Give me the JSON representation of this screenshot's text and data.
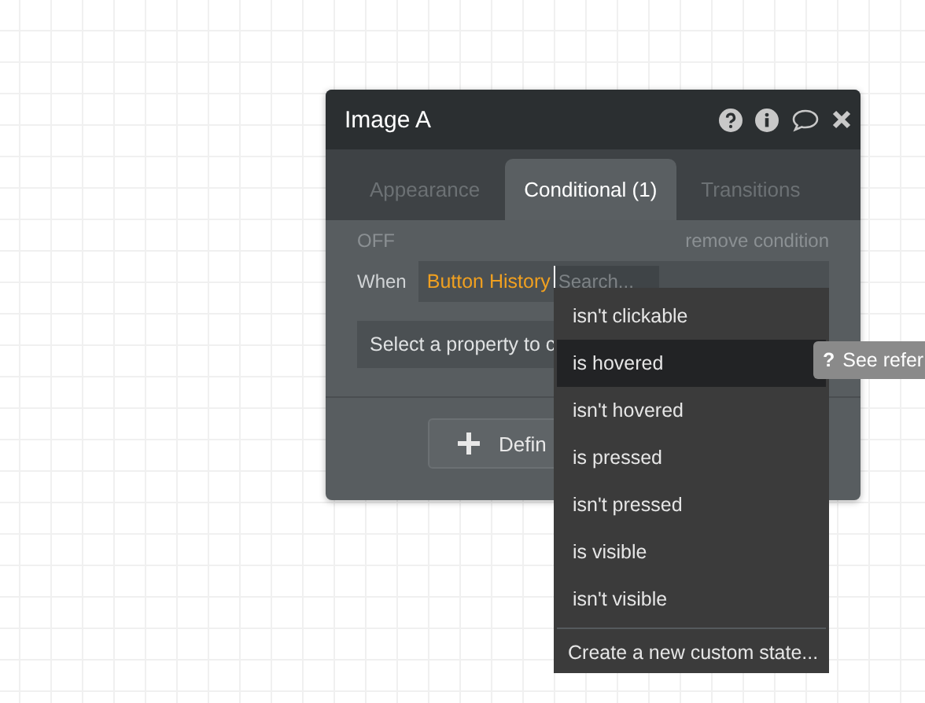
{
  "panel": {
    "title": "Image A",
    "tabs": [
      {
        "label": "Appearance",
        "selected": false
      },
      {
        "label": "Conditional (1)",
        "selected": true
      },
      {
        "label": "Transitions",
        "selected": false
      }
    ],
    "condition": {
      "status": "OFF",
      "remove_link": "remove condition",
      "when_label": "When",
      "expression": "Button History",
      "search": {
        "placeholder": "Search..."
      },
      "property_select": "Select a property to c"
    },
    "define_button": "Defin"
  },
  "dropdown": {
    "items": [
      {
        "kind": "state",
        "label": "isn't clickable",
        "selected": false
      },
      {
        "kind": "state",
        "label": "is hovered",
        "selected": true
      },
      {
        "kind": "state",
        "label": "isn't hovered",
        "selected": false
      },
      {
        "kind": "state",
        "label": "is pressed",
        "selected": false
      },
      {
        "kind": "state",
        "label": "isn't pressed",
        "selected": false
      },
      {
        "kind": "state",
        "label": "is visible",
        "selected": false
      },
      {
        "kind": "state",
        "label": "isn't visible",
        "selected": false
      },
      {
        "kind": "action",
        "label": "Create a new custom state...",
        "selected": false
      }
    ]
  },
  "tooltip": {
    "icon": "?",
    "text": "See refer"
  }
}
